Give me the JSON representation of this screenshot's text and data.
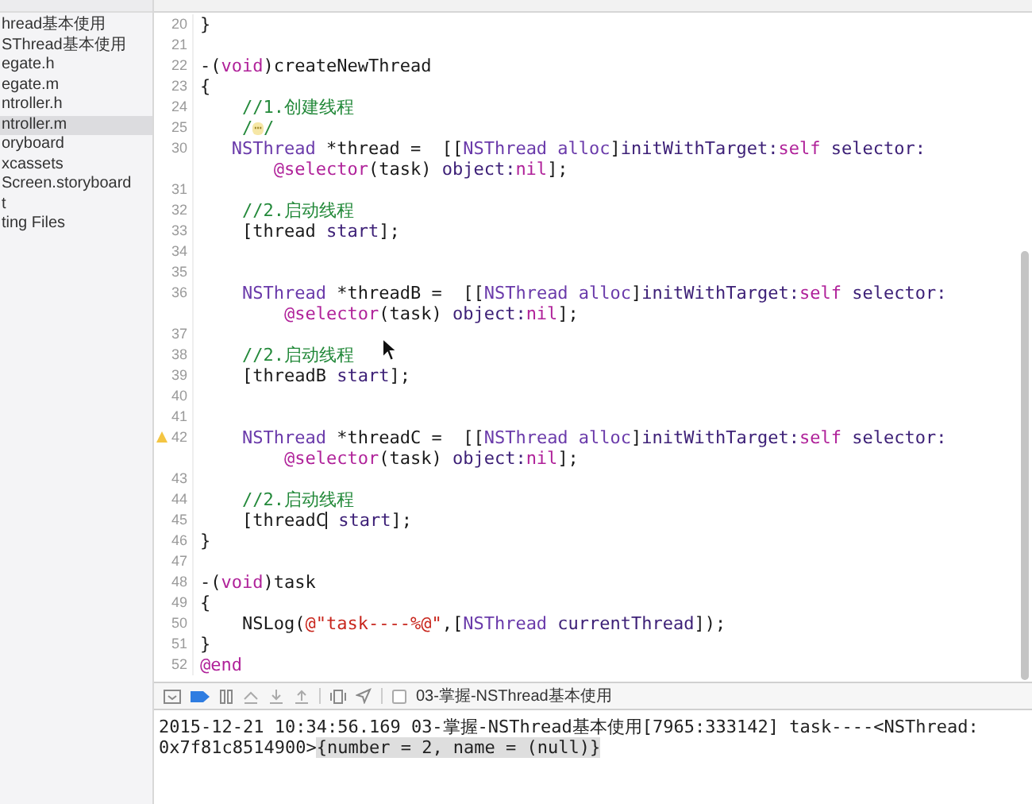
{
  "sidebar": {
    "items": [
      {
        "label": "hread基本使用",
        "selected": false
      },
      {
        "label": "SThread基本使用",
        "selected": false
      },
      {
        "label": "egate.h",
        "selected": false
      },
      {
        "label": "egate.m",
        "selected": false
      },
      {
        "label": "ntroller.h",
        "selected": false
      },
      {
        "label": "ntroller.m",
        "selected": true
      },
      {
        "label": "oryboard",
        "selected": false
      },
      {
        "label": "xcassets",
        "selected": false
      },
      {
        "label": "Screen.storyboard",
        "selected": false
      },
      {
        "label": "t",
        "selected": false
      },
      {
        "label": "ting Files",
        "selected": false
      }
    ]
  },
  "editor": {
    "lines": [
      {
        "number": "20",
        "warning": false,
        "tokens": [
          {
            "kind": "plain",
            "text": "}"
          }
        ]
      },
      {
        "number": "21",
        "warning": false
      },
      {
        "number": "22",
        "warning": false,
        "tokens": [
          {
            "kind": "plain",
            "text": "-("
          },
          {
            "kind": "keyword",
            "text": "void"
          },
          {
            "kind": "plain",
            "text": ")createNewThread"
          }
        ]
      },
      {
        "number": "23",
        "warning": false,
        "tokens": [
          {
            "kind": "plain",
            "text": "{"
          }
        ]
      },
      {
        "number": "24",
        "warning": false,
        "tokens": [
          {
            "kind": "comment",
            "text": "    //1.创建线程"
          }
        ]
      },
      {
        "number": "25",
        "warning": false,
        "tokens": [
          {
            "kind": "comment",
            "text": "    /"
          },
          {
            "kind": "fold",
            "text": "⋯"
          },
          {
            "kind": "comment",
            "text": "/"
          }
        ]
      },
      {
        "number": "30",
        "warning": false,
        "tokens": [
          {
            "kind": "type",
            "text": "   NSThread"
          },
          {
            "kind": "plain",
            "text": " *thread =  [["
          },
          {
            "kind": "type",
            "text": "NSThread alloc"
          },
          {
            "kind": "plain",
            "text": "]"
          },
          {
            "kind": "method",
            "text": "initWithTarget:"
          },
          {
            "kind": "keyword",
            "text": "self"
          },
          {
            "kind": "method",
            "text": " selector:"
          }
        ]
      },
      {
        "warning": false,
        "tokens": [
          {
            "kind": "keyword",
            "text": "       @selector"
          },
          {
            "kind": "plain",
            "text": "(task) "
          },
          {
            "kind": "method",
            "text": "object:"
          },
          {
            "kind": "keyword",
            "text": "nil"
          },
          {
            "kind": "plain",
            "text": "];"
          }
        ]
      },
      {
        "number": "31",
        "warning": false
      },
      {
        "number": "32",
        "warning": false,
        "tokens": [
          {
            "kind": "comment",
            "text": "    //2.启动线程"
          }
        ]
      },
      {
        "number": "33",
        "warning": false,
        "tokens": [
          {
            "kind": "plain",
            "text": "    [thread "
          },
          {
            "kind": "method",
            "text": "start"
          },
          {
            "kind": "plain",
            "text": "];"
          }
        ]
      },
      {
        "number": "34",
        "warning": false
      },
      {
        "number": "35",
        "warning": false
      },
      {
        "number": "36",
        "warning": false,
        "tokens": [
          {
            "kind": "type",
            "text": "    NSThread"
          },
          {
            "kind": "plain",
            "text": " *threadB =  [["
          },
          {
            "kind": "type",
            "text": "NSThread alloc"
          },
          {
            "kind": "plain",
            "text": "]"
          },
          {
            "kind": "method",
            "text": "initWithTarget:"
          },
          {
            "kind": "keyword",
            "text": "self"
          },
          {
            "kind": "method",
            "text": " selector:"
          }
        ]
      },
      {
        "warning": false,
        "tokens": [
          {
            "kind": "keyword",
            "text": "        @selector"
          },
          {
            "kind": "plain",
            "text": "(task) "
          },
          {
            "kind": "method",
            "text": "object:"
          },
          {
            "kind": "keyword",
            "text": "nil"
          },
          {
            "kind": "plain",
            "text": "];"
          }
        ]
      },
      {
        "number": "37",
        "warning": false
      },
      {
        "number": "38",
        "warning": false,
        "tokens": [
          {
            "kind": "comment",
            "text": "    //2.启动线程"
          }
        ]
      },
      {
        "number": "39",
        "warning": false,
        "tokens": [
          {
            "kind": "plain",
            "text": "    [threadB "
          },
          {
            "kind": "method",
            "text": "start"
          },
          {
            "kind": "plain",
            "text": "];"
          }
        ]
      },
      {
        "number": "40",
        "warning": false
      },
      {
        "number": "41",
        "warning": false
      },
      {
        "number": "42",
        "warning": true,
        "tokens": [
          {
            "kind": "type",
            "text": "    NSThread"
          },
          {
            "kind": "plain",
            "text": " *threadC =  [["
          },
          {
            "kind": "type",
            "text": "NSThread alloc"
          },
          {
            "kind": "plain",
            "text": "]"
          },
          {
            "kind": "method",
            "text": "initWithTarget:"
          },
          {
            "kind": "keyword",
            "text": "self"
          },
          {
            "kind": "method",
            "text": " selector:"
          }
        ]
      },
      {
        "warning": false,
        "tokens": [
          {
            "kind": "keyword",
            "text": "        @selector"
          },
          {
            "kind": "plain",
            "text": "(task) "
          },
          {
            "kind": "method",
            "text": "object:"
          },
          {
            "kind": "keyword",
            "text": "nil"
          },
          {
            "kind": "plain",
            "text": "];"
          }
        ]
      },
      {
        "number": "43",
        "warning": false
      },
      {
        "number": "44",
        "warning": false,
        "tokens": [
          {
            "kind": "comment",
            "text": "    //2.启动线程"
          }
        ]
      },
      {
        "number": "45",
        "warning": false,
        "tokens": [
          {
            "kind": "plain",
            "text": "    [threadC",
            "caret": true
          },
          {
            "kind": "method",
            "text": " start"
          },
          {
            "kind": "plain",
            "text": "];"
          }
        ]
      },
      {
        "number": "46",
        "warning": false,
        "tokens": [
          {
            "kind": "plain",
            "text": "}"
          }
        ]
      },
      {
        "number": "47",
        "warning": false
      },
      {
        "number": "48",
        "warning": false,
        "tokens": [
          {
            "kind": "plain",
            "text": "-("
          },
          {
            "kind": "keyword",
            "text": "void"
          },
          {
            "kind": "plain",
            "text": ")task"
          }
        ]
      },
      {
        "number": "49",
        "warning": false,
        "tokens": [
          {
            "kind": "plain",
            "text": "{"
          }
        ]
      },
      {
        "number": "50",
        "warning": false,
        "tokens": [
          {
            "kind": "plain",
            "text": "    NSLog("
          },
          {
            "kind": "string",
            "text": "@\"task----%@\""
          },
          {
            "kind": "plain",
            "text": ",["
          },
          {
            "kind": "type",
            "text": "NSThread"
          },
          {
            "kind": "method",
            "text": " currentThread"
          },
          {
            "kind": "plain",
            "text": "]);"
          }
        ]
      },
      {
        "number": "51",
        "warning": false,
        "tokens": [
          {
            "kind": "plain",
            "text": "}"
          }
        ]
      },
      {
        "number": "52",
        "warning": false,
        "tokens": [
          {
            "kind": "keyword",
            "text": "@end"
          }
        ]
      }
    ]
  },
  "debug_bar": {
    "target": "03-掌握-NSThread基本使用"
  },
  "console": {
    "lines": [
      {
        "segments": [
          {
            "text": "2015-12-21 10:34:56.169 03-掌握-NSThread基本使用[7965:333142] task----<NSThread:",
            "highlighted": false
          }
        ]
      },
      {
        "segments": [
          {
            "text": "0x7f81c8514900>",
            "highlighted": false
          },
          {
            "text": "{number = 2, name = (null)}",
            "highlighted": true
          }
        ]
      }
    ]
  }
}
